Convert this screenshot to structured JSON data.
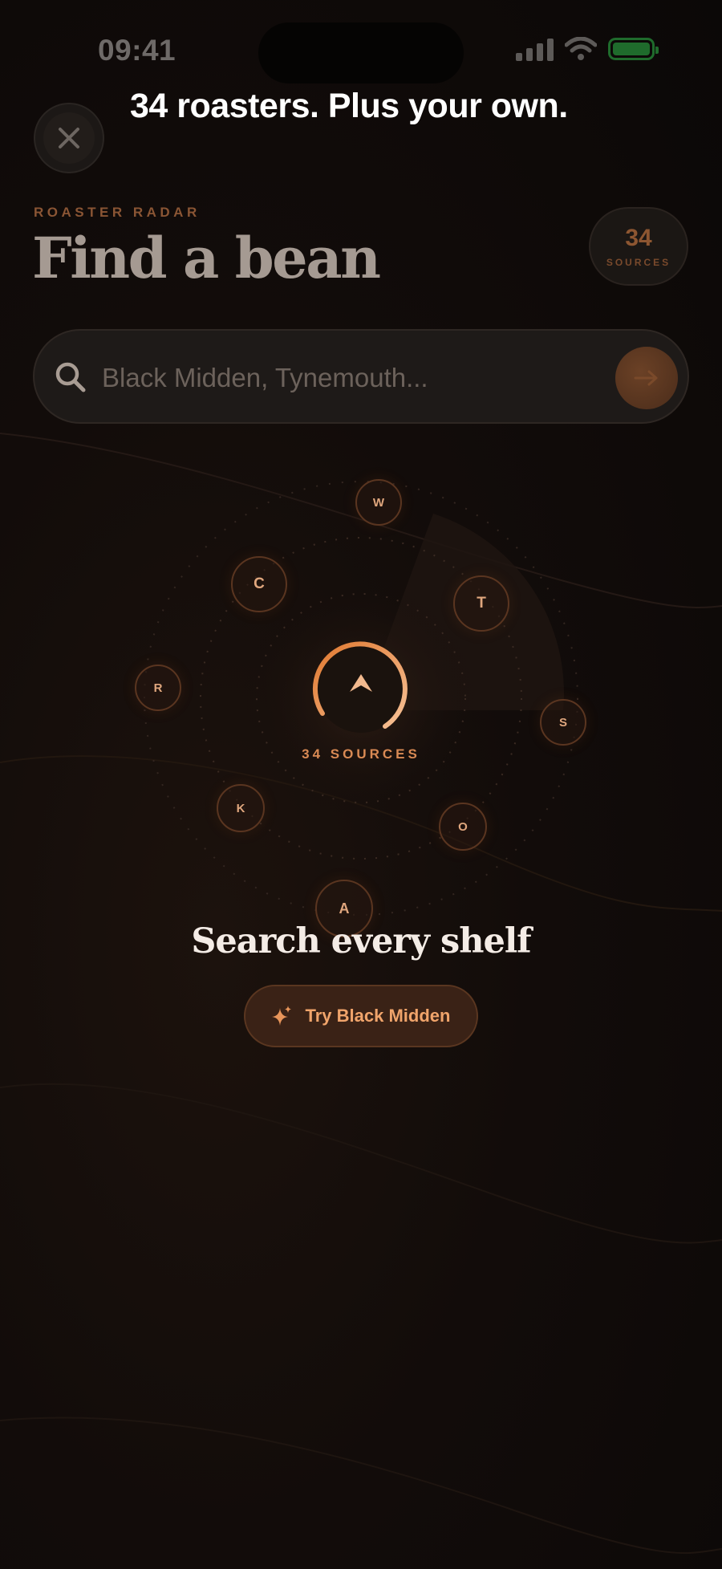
{
  "status_bar": {
    "time": "09:41"
  },
  "header": {
    "headline": "34 roasters. Plus your own.",
    "eyebrow": "ROASTER RADAR",
    "title": "Find a bean",
    "sources_count": "34",
    "sources_label": "SOURCES"
  },
  "search": {
    "placeholder": "Black Midden, Tynemouth..."
  },
  "radar": {
    "caption": "34 SOURCES",
    "nodes": [
      "W",
      "C",
      "T",
      "R",
      "S",
      "K",
      "O",
      "A"
    ]
  },
  "cta": {
    "title": "Search every shelf",
    "button_label": "Try Black Midden"
  },
  "colors": {
    "accent": "#e08a4a",
    "background": "#120c0a"
  }
}
